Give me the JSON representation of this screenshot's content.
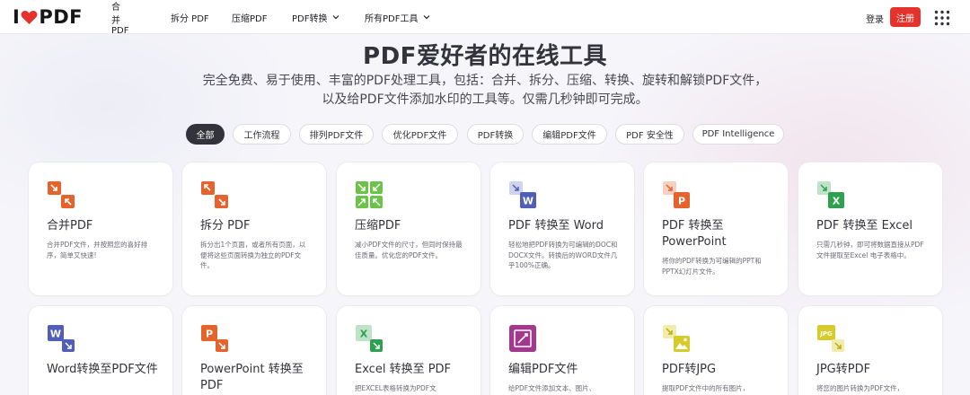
{
  "header": {
    "logo_left": "I",
    "logo_right": "PDF",
    "nav": [
      {
        "label": "合并PDF"
      },
      {
        "label": "拆分 PDF"
      },
      {
        "label": "压缩PDF"
      },
      {
        "label": "PDF转换"
      },
      {
        "label": "所有PDF工具"
      }
    ],
    "login_label": "登录",
    "register_label": "注册",
    "brand_color": "#e5322d"
  },
  "hero": {
    "title": "PDF爱好者的在线工具",
    "subtitle": "完全免费、易于使用、丰富的PDF处理工具，包括：合并、拆分、压缩、转换、旋转和解锁PDF文件，以及给PDF文件添加水印的工具等。仅需几秒钟即可完成。"
  },
  "filters": [
    {
      "label": "全部",
      "active": true
    },
    {
      "label": "工作流程"
    },
    {
      "label": "排列PDF文件"
    },
    {
      "label": "优化PDF文件"
    },
    {
      "label": "PDF转换"
    },
    {
      "label": "编辑PDF文件"
    },
    {
      "label": "PDF 安全性"
    },
    {
      "label": "PDF Intelligence"
    }
  ],
  "tools": [
    {
      "title": "合并PDF",
      "desc": "合并PDF文件，并按照您的喜好排序，简单又快速!",
      "icon": "merge-icon",
      "color": "#e5632d"
    },
    {
      "title": "拆分 PDF",
      "desc": "拆分出1个页面，或者所有页面，以便将这些页面转换为独立的PDF文件。",
      "icon": "split-icon",
      "color": "#e5632d"
    },
    {
      "title": "压缩PDF",
      "desc": "减小PDF文件的尺寸，但同时保持最佳质量。优化您的PDF文件。",
      "icon": "compress-icon",
      "color": "#6cc24a"
    },
    {
      "title": "PDF 转换至 Word",
      "desc": "轻松地把PDF转换为可编辑的DOC和DOCX文件。转换后的WORD文件几乎100%正确。",
      "icon": "pdf-to-word-icon",
      "color": "#4f5eb8"
    },
    {
      "title": "PDF 转换至 PowerPoint",
      "desc": "将你的PDF转换为可编辑的PPT和PPTX幻灯片文件。",
      "icon": "pdf-to-ppt-icon",
      "color": "#e5632d"
    },
    {
      "title": "PDF 转换至 Excel",
      "desc": "只需几秒钟，即可将数据直接从PDF文件提取至Excel 电子表格中。",
      "icon": "pdf-to-excel-icon",
      "color": "#2fa050"
    },
    {
      "title": "Word转换至PDF文件",
      "desc": "",
      "icon": "word-to-pdf-icon",
      "color": "#4f5eb8"
    },
    {
      "title": "PowerPoint 转换至 PDF",
      "desc": "",
      "icon": "ppt-to-pdf-icon",
      "color": "#e5632d"
    },
    {
      "title": "Excel 转换至 PDF",
      "desc": "把EXCEL表格转换为PDF文",
      "icon": "excel-to-pdf-icon",
      "color": "#2fa050"
    },
    {
      "title": "编辑PDF文件",
      "desc": "给PDF文件添加文本、图片、",
      "icon": "edit-pdf-icon",
      "color": "#a3388f"
    },
    {
      "title": "PDF转JPG",
      "desc": "提取PDF文件中的所有图片，",
      "icon": "pdf-to-jpg-icon",
      "color": "#d8cb29"
    },
    {
      "title": "JPG转PDF",
      "desc": "将您的图片转换为PDF文件，",
      "icon": "jpg-to-pdf-icon",
      "color": "#d8cb29"
    }
  ]
}
